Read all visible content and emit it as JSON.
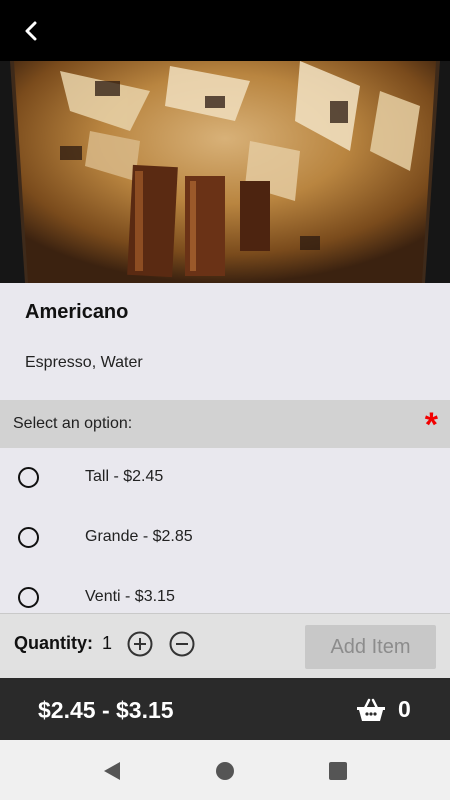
{
  "header": {
    "back_icon": "chevron-left-icon"
  },
  "product": {
    "image_subject": "iced-americano-cup-photo",
    "name": "Americano",
    "description": "Espresso, Water"
  },
  "options": {
    "header_label": "Select an option:",
    "required_mark": "*",
    "required_color": "#f20000",
    "items": [
      {
        "label": "Tall - $2.45",
        "selected": false
      },
      {
        "label": "Grande - $2.85",
        "selected": false
      },
      {
        "label": "Venti - $3.15",
        "selected": false
      }
    ]
  },
  "quantity": {
    "label": "Quantity:",
    "value": "1",
    "increase_icon": "plus-circle-icon",
    "decrease_icon": "minus-circle-icon",
    "add_button_label": "Add Item",
    "add_button_enabled": false
  },
  "footer": {
    "price_range": "$2.45 - $3.15",
    "cart_icon": "basket-icon",
    "cart_count": "0"
  },
  "system_nav": {
    "back": "triangle-back-icon",
    "home": "circle-home-icon",
    "recents": "square-recents-icon"
  }
}
